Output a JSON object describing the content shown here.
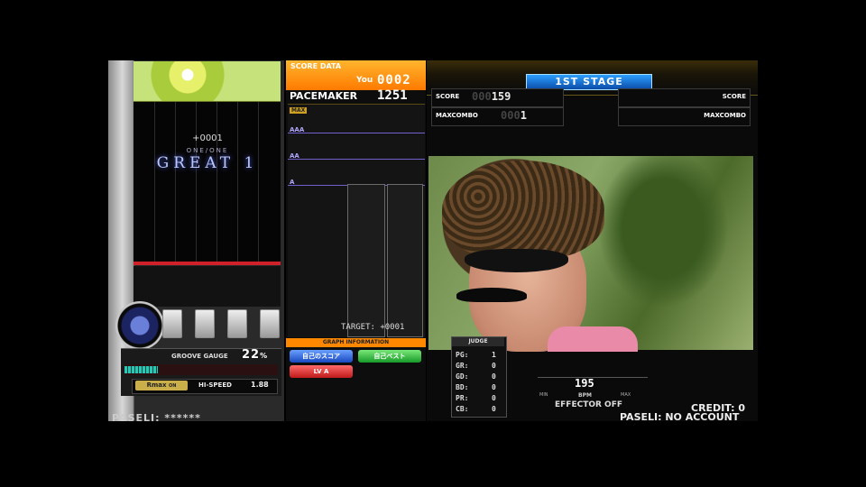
{
  "play": {
    "judge_plus": "+0001",
    "judge_sub": "ONE/ONE",
    "judge_main": "GREAT 1",
    "gauge_label": "GROOVE GAUGE",
    "gauge_value": "22",
    "gauge_unit": "%",
    "gauge_fraction": 0.22,
    "random_label": "Rmax",
    "random_sub": "ON",
    "hispeed_label": "HI-SPEED",
    "hispeed_value": "1.88",
    "paseli": "PASELI: ******"
  },
  "score_panel": {
    "header": "SCORE DATA",
    "you_label": "You",
    "you_value": "0002",
    "pacemaker_label": "PACEMAKER",
    "pacemaker_value": "1251",
    "grades": [
      "MAX",
      "AAA",
      "AA",
      "A"
    ],
    "target": "TARGET: +0001",
    "graph_info": "GRAPH INFORMATION",
    "buttons": [
      "自己のスコア",
      "自己ベスト",
      "LV A"
    ]
  },
  "stage": {
    "title": "1ST STAGE",
    "p1_score_label": "SCORE",
    "p1_score_ghost": "000",
    "p1_score_value": "159",
    "p1_combo_label": "MAXCOMBO",
    "p1_combo_ghost": "000",
    "p1_combo_value": "1",
    "p2_score_label": "SCORE",
    "p2_combo_label": "MAXCOMBO"
  },
  "judge": {
    "title": "JUDGE",
    "rows": [
      {
        "label": "PG:",
        "value": "1"
      },
      {
        "label": "GR:",
        "value": "0"
      },
      {
        "label": "GD:",
        "value": "0"
      },
      {
        "label": "BD:",
        "value": "0"
      },
      {
        "label": "PR:",
        "value": "0"
      },
      {
        "label": "CB:",
        "value": "0"
      }
    ]
  },
  "bpm": {
    "value": "195",
    "label": "BPM",
    "min_label": "MIN",
    "max_label": "MAX"
  },
  "effector": "EFFECTOR OFF",
  "credit": "CREDIT: 0",
  "paseli_right": "PASELI: NO ACCOUNT"
}
